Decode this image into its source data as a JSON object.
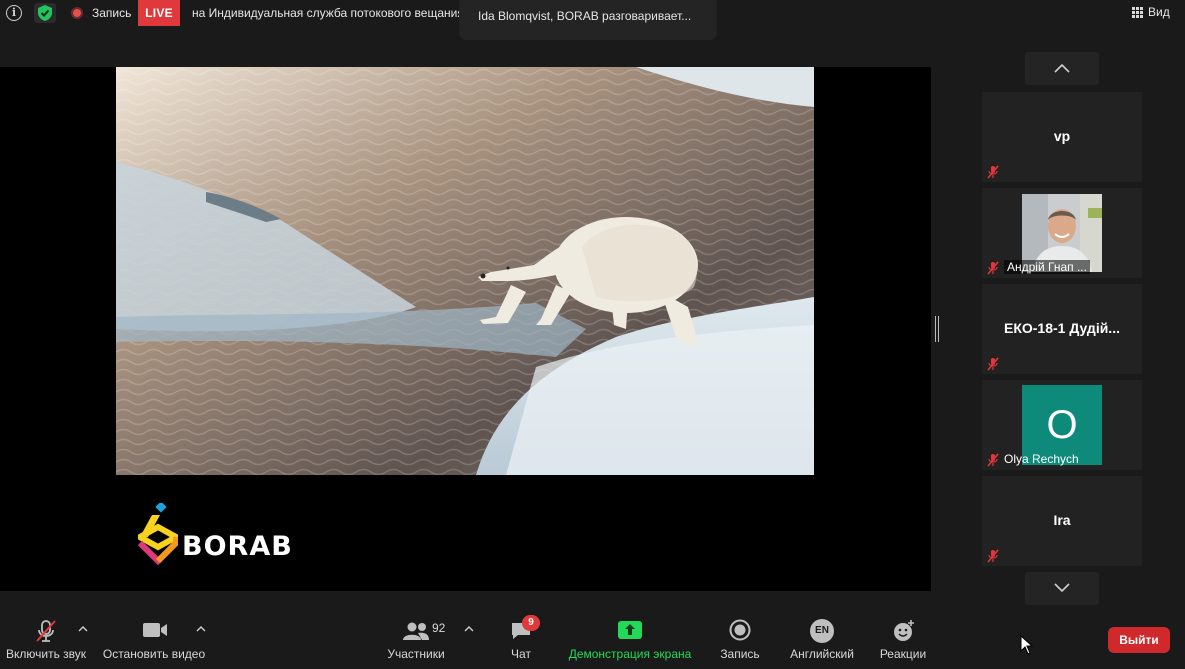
{
  "top_bar": {
    "recording_label": "Запись",
    "live_badge": "LIVE",
    "live_text": "на Индивидуальная служба потокового вещания",
    "active_speaker": "Ida Blomqvist, BORAB разговаривает...",
    "view_label": "Вид"
  },
  "share": {
    "logo_text": "BORAB"
  },
  "gallery": {
    "tiles": [
      {
        "name": "vp",
        "kind": "name"
      },
      {
        "name": "Андрій Гнап ...",
        "kind": "photo"
      },
      {
        "name": "ЕКО-18-1 Дудій...",
        "kind": "name"
      },
      {
        "name": "Olya Rechych",
        "kind": "letter",
        "letter": "O"
      },
      {
        "name": "Ira",
        "kind": "name"
      }
    ]
  },
  "toolbar": {
    "unmute_label": "Включить звук",
    "stop_video_label": "Остановить видео",
    "participants_label": "Участники",
    "participants_count": "92",
    "chat_label": "Чат",
    "chat_badge": "9",
    "share_screen_label": "Демонстрация экрана",
    "record_label": "Запись",
    "language_code": "EN",
    "language_label": "Английский",
    "reactions_label": "Реакции",
    "leave_label": "Выйти"
  },
  "colors": {
    "live_red": "#e0393b",
    "share_green": "#23d959",
    "leave_red": "#d0292b",
    "avatar_teal": "#0e8a7a"
  }
}
